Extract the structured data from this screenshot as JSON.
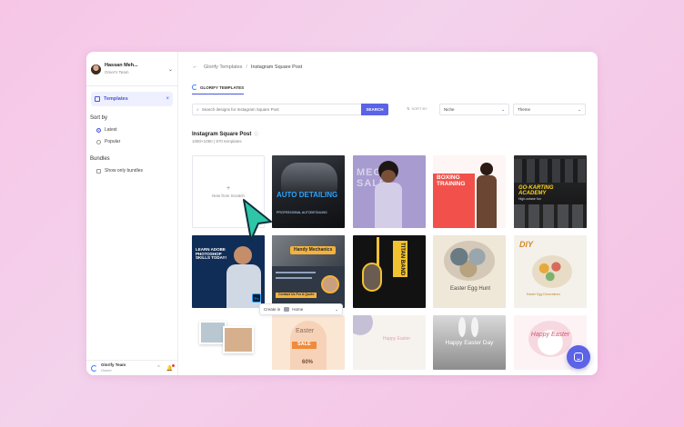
{
  "user": {
    "name": "Hassan Meh...",
    "team": "Omer's Team"
  },
  "nav": {
    "active_label": "Templates"
  },
  "filters": {
    "sort_title": "Sort by",
    "sort_options": [
      "Latest",
      "Popular"
    ],
    "bundles_title": "Bundles",
    "bundles_option": "Show only bundles"
  },
  "bottom": {
    "team_name": "Glorify Team",
    "role": "Owner"
  },
  "breadcrumb": {
    "root": "Glorify Templates",
    "current": "Instagram Square Post"
  },
  "tab": {
    "label": "GLORIFY TEMPLATES"
  },
  "search": {
    "placeholder": "Search designs for Instagram Square Post",
    "button": "SEARCH"
  },
  "sort": {
    "label": "SORT BY",
    "niche": "Niche",
    "theme": "Theme"
  },
  "section": {
    "title": "Instagram Square Post",
    "subtitle": "1080×1080 | 970 templates"
  },
  "cards": {
    "new": "New from Scratch",
    "c1_title": "AUTO DETAILING",
    "c1_sub": "PROFESSIONAL AUTODETAILING",
    "c2_title": "MEGA SALE",
    "c3_title": "BOXING TRAINING",
    "c4_title": "GO-KARTING ACADEMY",
    "c4_sub": "High-octane fun",
    "c5_title": "LEARN ADOBE PHOTOSHOP SKILLS TODAY!",
    "c5_badge": "Ps",
    "c6_title": "Handy Mechanics",
    "c6_sub": "Contact Us For A Quote",
    "c7_title": "TITAN BAND",
    "c8_title": "Easter Egg Hunt",
    "c9_title": "DIY",
    "c9_sub": "Easter Egg Decorations",
    "c11_title": "Easter",
    "c11_sale": "SALE",
    "c11_pct": "60%",
    "c12_title": "Happy Easter",
    "c13_title": "Happy Easter Day",
    "c14_title": "Happy Easter"
  },
  "createbar": {
    "prefix": "Create in",
    "location": "Home"
  },
  "colors": {
    "accent": "#5b63e6",
    "background": "#f6c8e6"
  }
}
